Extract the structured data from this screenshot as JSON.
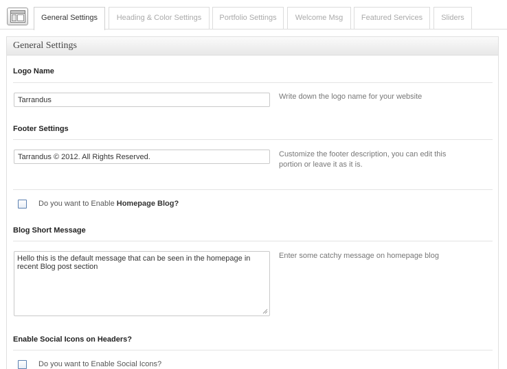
{
  "tabs": [
    {
      "label": "General Settings",
      "active": true
    },
    {
      "label": "Heading & Color Settings",
      "active": false
    },
    {
      "label": "Portfolio Settings",
      "active": false
    },
    {
      "label": "Welcome Msg",
      "active": false
    },
    {
      "label": "Featured Services",
      "active": false
    },
    {
      "label": "Sliders",
      "active": false
    }
  ],
  "page_icon": "theme-options-icon",
  "panel": {
    "title": "General Settings",
    "logo": {
      "title": "Logo Name",
      "value": "Tarrandus",
      "help": "Write down the logo name for your website"
    },
    "footer": {
      "title": "Footer Settings",
      "value": "Tarrandus © 2012. All Rights Reserved.",
      "help": "Customize the footer description, you can edit this portion or leave it as it is."
    },
    "homepage_blog": {
      "label_prefix": "Do you want to Enable ",
      "label_bold": "Homepage Blog?",
      "checked": false
    },
    "blog_message": {
      "title": "Blog Short Message",
      "value": "Hello this is the default message that can be seen in the homepage in recent Blog post section",
      "help": "Enter some catchy message on homepage blog"
    },
    "social": {
      "title": "Enable Social Icons on Headers?",
      "label": "Do you want to Enable Social Icons?",
      "checked": false
    }
  },
  "colors": {
    "checkbox_border": "#5a7fb0",
    "tab_border": "#dcdcdc"
  }
}
